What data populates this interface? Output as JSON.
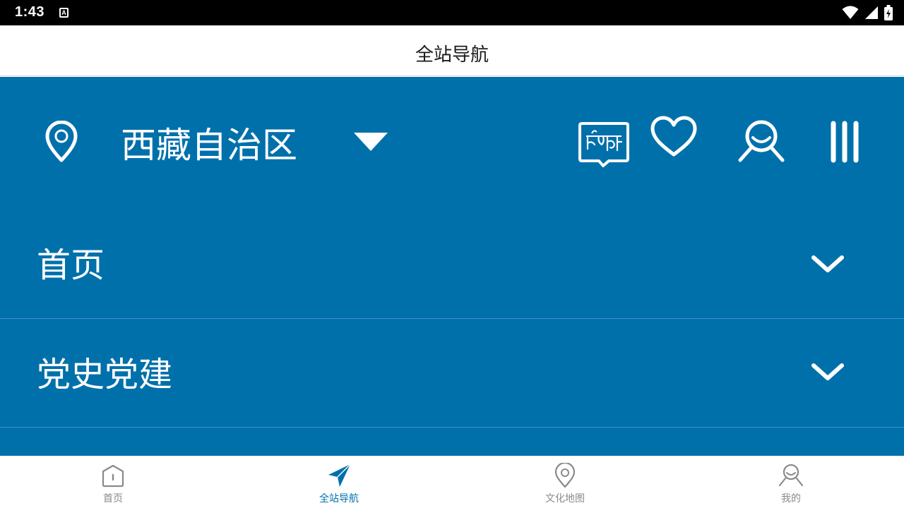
{
  "status_bar": {
    "time": "1:43",
    "notification_badge": "A",
    "icons": [
      "wifi-icon",
      "cell-signal-icon",
      "battery-charging-icon"
    ]
  },
  "header": {
    "title": "全站导航"
  },
  "region": {
    "name": "西藏自治区",
    "icon": "location-pin-icon",
    "dropdown_icon": "triangle-down-icon"
  },
  "toolbar": {
    "icons": [
      "tibetan-language-icon",
      "heart-icon",
      "user-icon",
      "menu-bars-icon"
    ]
  },
  "menu": {
    "items": [
      {
        "label": "首页",
        "icon": "chevron-down-icon"
      },
      {
        "label": "党史党建",
        "icon": "chevron-down-icon"
      }
    ]
  },
  "bottom_nav": {
    "tabs": [
      {
        "label": "首页",
        "icon": "home-icon",
        "active": false
      },
      {
        "label": "全站导航",
        "icon": "navigation-icon",
        "active": true
      },
      {
        "label": "文化地图",
        "icon": "map-pin-icon",
        "active": false
      },
      {
        "label": "我的",
        "icon": "profile-icon",
        "active": false
      }
    ]
  },
  "colors": {
    "primary": "#0070ab",
    "status_bar": "#000000",
    "inactive_tab": "#8a8a8a",
    "divider": "#3d92c4"
  }
}
